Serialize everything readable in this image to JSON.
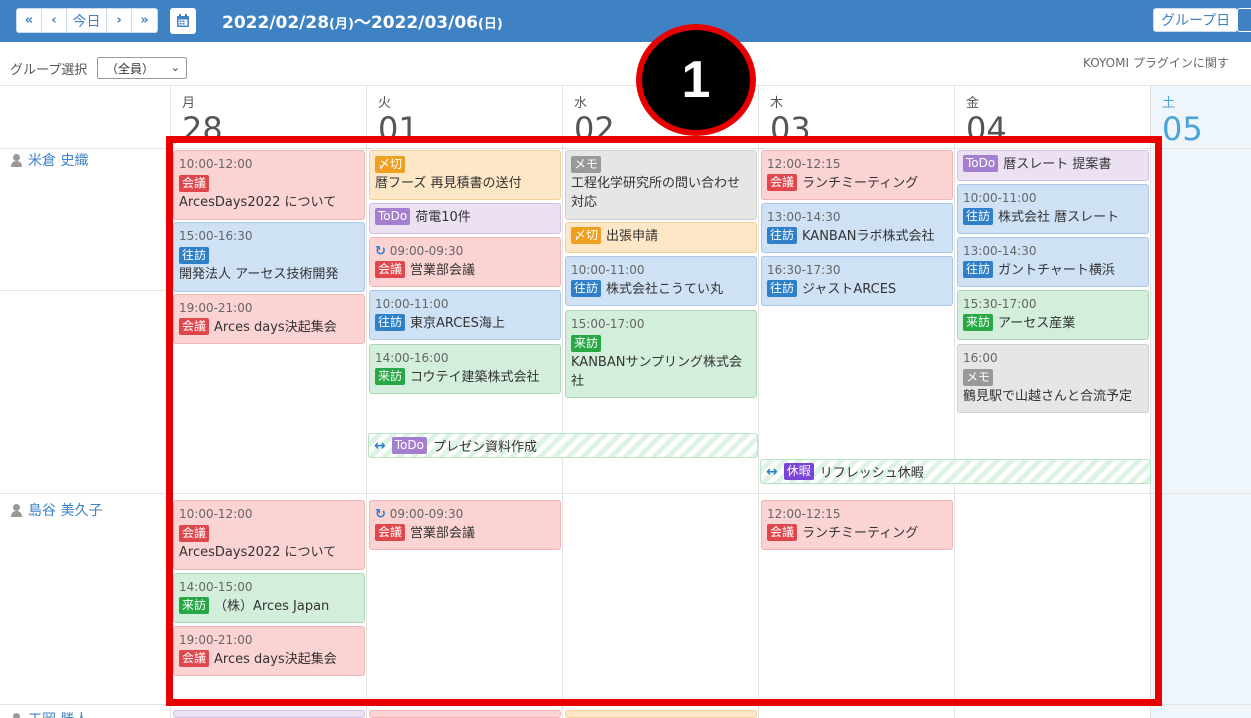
{
  "toolbar": {
    "first_label": "«",
    "prev_label": "‹",
    "today_label": "今日",
    "next_label": "›",
    "last_label": "»",
    "calendar_icon": "calendar-icon",
    "date_start": "2022/02/28",
    "date_start_wd": "(月)",
    "date_sep": "～",
    "date_end": "2022/03/06",
    "date_end_wd": "(日)",
    "group_day_label": "グループ日"
  },
  "filter": {
    "label": "グループ選択",
    "value": "（全員）",
    "note": "KOYOMI プラグインに関す"
  },
  "days": [
    {
      "wd": "月",
      "dn": "28"
    },
    {
      "wd": "火",
      "dn": "01"
    },
    {
      "wd": "水",
      "dn": "02"
    },
    {
      "wd": "木",
      "dn": "03"
    },
    {
      "wd": "金",
      "dn": "04"
    },
    {
      "wd": "土",
      "dn": "05"
    }
  ],
  "members": [
    "米倉 史織",
    "島谷 美久子",
    "工岡 勝人"
  ],
  "tags": {
    "meeting": "会議",
    "visit": "往訪",
    "incoming": "来訪",
    "todo": "ToDo",
    "memo": "メモ",
    "deadline": "〆切",
    "leave": "休暇"
  },
  "events": {
    "m1_mon_1": {
      "time": "10:00-12:00",
      "title": "ArcesDays2022 について"
    },
    "m1_mon_2": {
      "time": "15:00-16:30",
      "title": "開発法人 アーセス技術開発"
    },
    "m1_mon_3": {
      "time": "19:00-21:00",
      "title": "Arces days決起集会"
    },
    "m1_tue_1": {
      "title": "暦フーズ 再見積書の送付"
    },
    "m1_tue_2": {
      "title": "荷電10件"
    },
    "m1_tue_3": {
      "time": "09:00-09:30",
      "title": "営業部会議"
    },
    "m1_tue_4": {
      "time": "10:00-11:00",
      "title": "東京ARCES海上"
    },
    "m1_tue_5": {
      "time": "14:00-16:00",
      "title": "コウテイ建築株式会社"
    },
    "m1_wed_1": {
      "title": "工程化学研究所の問い合わせ対応"
    },
    "m1_wed_2": {
      "title": "出張申請"
    },
    "m1_wed_3": {
      "time": "10:00-11:00",
      "title": "株式会社こうてい丸"
    },
    "m1_wed_4": {
      "time": "15:00-17:00",
      "title": "KANBANサンプリング株式会社"
    },
    "m1_thu_1": {
      "time": "12:00-12:15",
      "title": "ランチミーティング"
    },
    "m1_thu_2": {
      "time": "13:00-14:30",
      "title": "KANBANラボ株式会社"
    },
    "m1_thu_3": {
      "time": "16:30-17:30",
      "title": "ジャストARCES"
    },
    "m1_fri_1": {
      "title": "暦スレート 提案書"
    },
    "m1_fri_2": {
      "time": "10:00-11:00",
      "title": "株式会社 暦スレート"
    },
    "m1_fri_3": {
      "time": "13:00-14:30",
      "title": "ガントチャート横浜"
    },
    "m1_fri_4": {
      "time": "15:30-17:00",
      "title": "アーセス産業"
    },
    "m1_fri_5": {
      "time": "16:00",
      "title": "鶴見駅で山越さんと合流予定"
    },
    "span_1": {
      "title": "プレゼン資料作成"
    },
    "span_2": {
      "title": "リフレッシュ休暇"
    },
    "m2_mon_1": {
      "time": "10:00-12:00",
      "title": "ArcesDays2022 について"
    },
    "m2_mon_2": {
      "time": "14:00-15:00",
      "title": "（株）Arces Japan"
    },
    "m2_mon_3": {
      "time": "19:00-21:00",
      "title": "Arces days決起集会"
    },
    "m2_tue_1": {
      "time": "09:00-09:30",
      "title": "営業部会議"
    },
    "m2_thu_1": {
      "time": "12:00-12:15",
      "title": "ランチミーティング"
    }
  },
  "annotation": {
    "number": "1"
  },
  "colors": {
    "header": "#3f82c4",
    "highlight": "#e80000",
    "saturday": "#4aa5d6"
  }
}
